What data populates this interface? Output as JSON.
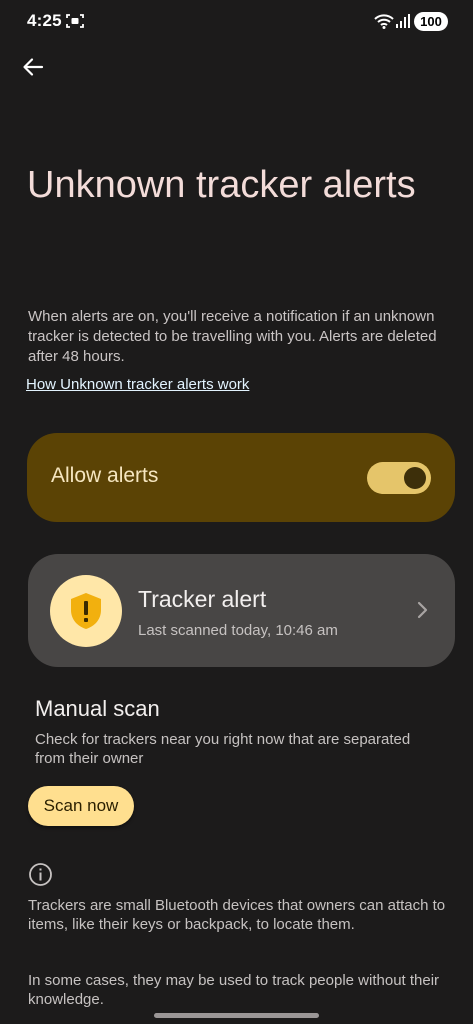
{
  "status_bar": {
    "time": "4:25",
    "battery": "100",
    "icons": [
      "screenshot-icon",
      "wifi-icon",
      "signal-icon"
    ]
  },
  "header": {
    "back_icon": "arrow-left-icon",
    "title": "Unknown tracker alerts"
  },
  "intro": {
    "description": "When alerts are on, you'll receive a notification if an unknown tracker is detected to be travelling with you. Alerts are deleted after 48 hours.",
    "link": "How Unknown tracker alerts work"
  },
  "allow_alerts": {
    "label": "Allow alerts",
    "enabled": true
  },
  "tracker_alert": {
    "title": "Tracker alert",
    "subtitle": "Last scanned today, 10:46 am",
    "icon": "shield-alert-icon"
  },
  "manual_scan": {
    "title": "Manual scan",
    "description": "Check for trackers near you right now that are separated from their owner",
    "button": "Scan now"
  },
  "info": {
    "icon": "info-icon",
    "paragraph_1": "Trackers are small Bluetooth devices that owners can attach to items, like their keys or backpack, to locate them.",
    "paragraph_2": "In some cases, they may be used to track people without their knowledge."
  },
  "colors": {
    "background": "#1c1b1b",
    "allow_card": "#5b4305",
    "toggle_track": "#e5c56a",
    "tracker_card": "#484645",
    "scan_button": "#ffdf8f",
    "shield_bg": "#ffe7a8",
    "shield_fg": "#f2b00e"
  }
}
